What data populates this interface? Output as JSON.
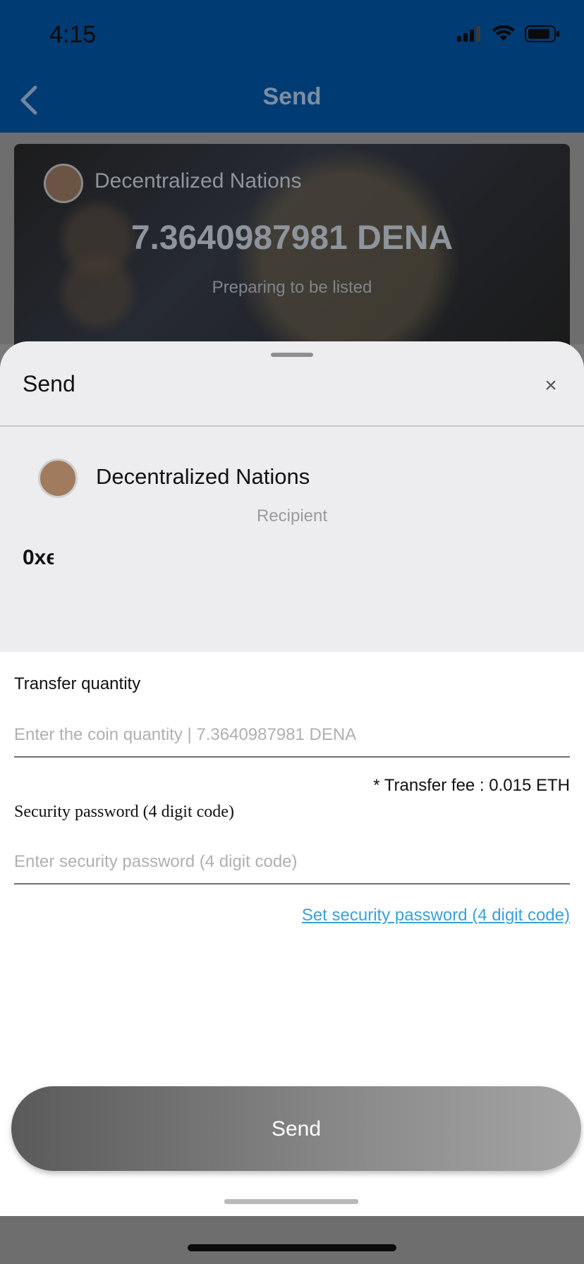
{
  "status_bar": {
    "time": "4:15"
  },
  "nav": {
    "title": "Send"
  },
  "card": {
    "token_name": "Decentralized Nations",
    "amount": "7.3640987981 DENA",
    "status": "Preparing to be listed"
  },
  "sheet": {
    "title": "Send",
    "close": "×",
    "token_name": "Decentralized Nations",
    "recipient_label": "Recipient",
    "recipient_value": "0xe"
  },
  "form": {
    "quantity_label": "Transfer quantity",
    "quantity_placeholder": "Enter the coin quantity | 7.3640987981 DENA",
    "fee": "* Transfer fee : 0.015 ETH",
    "password_label": "Security password (4 digit code)",
    "password_placeholder": "Enter security password (4 digit code)",
    "set_password_link": "Set security password (4 digit code)",
    "send_label": "Send"
  }
}
